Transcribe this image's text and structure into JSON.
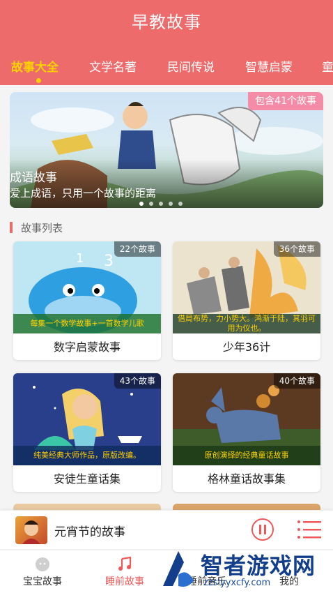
{
  "header": {
    "title": "早教故事",
    "tabs": [
      "故事大全",
      "文学名著",
      "民间传说",
      "智慧启蒙",
      "童"
    ],
    "active_tab": 0
  },
  "banner": {
    "badge": "包含41个故事",
    "title": "成语故事",
    "subtitle": "爱上成语，只用一个故事的距离"
  },
  "section": {
    "title": "故事列表"
  },
  "cards": [
    {
      "count": "22个故事",
      "caption": "每集一个数学故事+一首数学儿歌",
      "title": "数字启蒙故事",
      "image_icon": "whale-illustration"
    },
    {
      "count": "36个故事",
      "caption": "借局布势，力小势大。鸿渐于陆，其羽可用为仪也。",
      "title": "少年36计",
      "image_icon": "battle-illustration"
    },
    {
      "count": "43个故事",
      "caption": "纯美经典大师作品，原版改编。",
      "title": "安徒生童话集",
      "image_icon": "mermaid-illustration"
    },
    {
      "count": "40个故事",
      "caption": "原创演绎的经典童话故事",
      "title": "格林童话故事集",
      "image_icon": "donkey-illustration"
    }
  ],
  "player": {
    "title": "元宵节的故事",
    "pause_icon": "pause-icon",
    "list_icon": "playlist-icon"
  },
  "tabbar": {
    "items": [
      {
        "label": "宝宝故事",
        "icon": "baby-icon"
      },
      {
        "label": "睡前故事",
        "icon": "music-note-icon"
      },
      {
        "label": "睡前音乐",
        "icon": "music-icon"
      },
      {
        "label": "我的",
        "icon": "person-icon"
      }
    ],
    "active": 1
  },
  "watermark": {
    "text": "智者游戏网",
    "url": "zzslyyxcfy.com"
  },
  "colors": {
    "primary": "#ee6b6b",
    "active_tab": "#ffd200",
    "accent_red": "#ee5a5a"
  }
}
